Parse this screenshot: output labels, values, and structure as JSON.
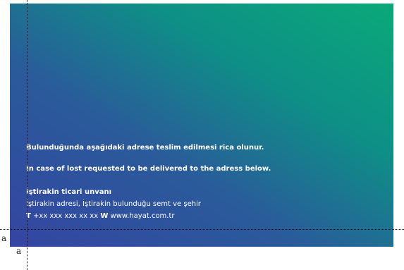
{
  "card": {
    "lines": {
      "tr_notice": "Bulunduğunda aşağıdaki adrese teslim edilmesi rica olunur.",
      "en_notice": "In case of lost requested to be delivered to the adress below.",
      "company_name": "İştirakin ticari unvanı",
      "company_address": "İştirakin adresi, İştirakin bulunduğu semt ve şehir",
      "phone_prefix": "T",
      "phone_value": "+xx xxx xxx xx xx",
      "web_prefix": "W",
      "web_value": "www.hayat.com.tr"
    },
    "gradient_colors": [
      "#0aa978",
      "#0e8f86",
      "#2a5b9a",
      "#3445a2"
    ]
  },
  "guides": {
    "label_horizontal": "a",
    "label_vertical": "a"
  }
}
